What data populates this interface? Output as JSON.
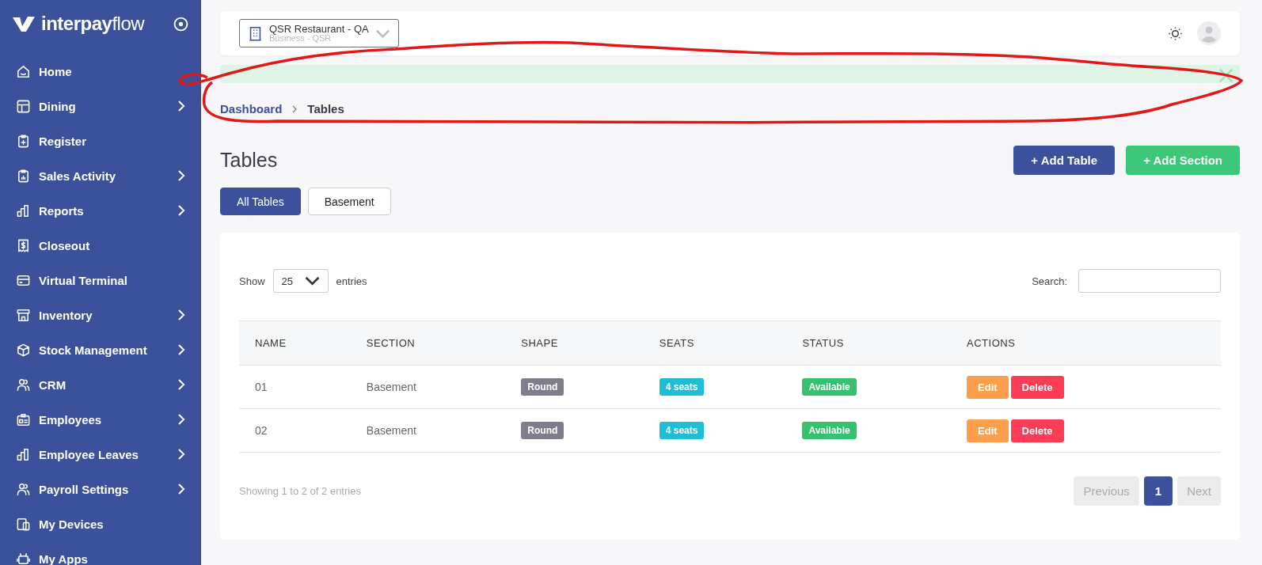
{
  "brand": {
    "name_bold": "interpay",
    "name_light": "flow"
  },
  "sidebar": {
    "items": [
      {
        "label": "Home",
        "has_submenu": false
      },
      {
        "label": "Dining",
        "has_submenu": true
      },
      {
        "label": "Register",
        "has_submenu": false
      },
      {
        "label": "Sales Activity",
        "has_submenu": true
      },
      {
        "label": "Reports",
        "has_submenu": true
      },
      {
        "label": "Closeout",
        "has_submenu": false
      },
      {
        "label": "Virtual Terminal",
        "has_submenu": false
      },
      {
        "label": "Inventory",
        "has_submenu": true
      },
      {
        "label": "Stock Management",
        "has_submenu": true
      },
      {
        "label": "CRM",
        "has_submenu": true
      },
      {
        "label": "Employees",
        "has_submenu": true
      },
      {
        "label": "Employee Leaves",
        "has_submenu": true
      },
      {
        "label": "Payroll Settings",
        "has_submenu": true
      },
      {
        "label": "My Devices",
        "has_submenu": false
      },
      {
        "label": "My Apps",
        "has_submenu": false
      }
    ]
  },
  "header": {
    "business": {
      "name": "QSR Restaurant - QA",
      "subtitle": "Business - QSR"
    }
  },
  "breadcrumb": [
    {
      "label": "Dashboard",
      "link": true
    },
    {
      "label": "Tables",
      "link": false
    }
  ],
  "page_title": "Tables",
  "actions": [
    {
      "label": "+ Add Table",
      "kind": "primary"
    },
    {
      "label": "+ Add Section",
      "kind": "success"
    }
  ],
  "tabs": [
    {
      "label": "All Tables",
      "selected": true
    },
    {
      "label": "Basement",
      "selected": false
    }
  ],
  "table": {
    "length": {
      "prefix": "Show",
      "value": "25",
      "suffix": "entries"
    },
    "search": {
      "label": "Search:"
    },
    "columns": [
      "NAME",
      "SECTION",
      "SHAPE",
      "SEATS",
      "STATUS",
      "ACTIONS"
    ],
    "rows": [
      {
        "name": "01",
        "section": "Basement",
        "shape": "Round",
        "seats": "4 seats",
        "status": "Available",
        "actions": [
          "Edit",
          "Delete"
        ]
      },
      {
        "name": "02",
        "section": "Basement",
        "shape": "Round",
        "seats": "4 seats",
        "status": "Available",
        "actions": [
          "Edit",
          "Delete"
        ]
      }
    ],
    "info": "Showing 1 to 2 of 2 entries",
    "pagination": [
      {
        "label": "Previous",
        "kind": "prev",
        "selected": false,
        "disabled": true
      },
      {
        "label": "1",
        "kind": "page",
        "selected": true,
        "disabled": false
      },
      {
        "label": "Next",
        "kind": "next",
        "selected": false,
        "disabled": true
      }
    ]
  }
}
